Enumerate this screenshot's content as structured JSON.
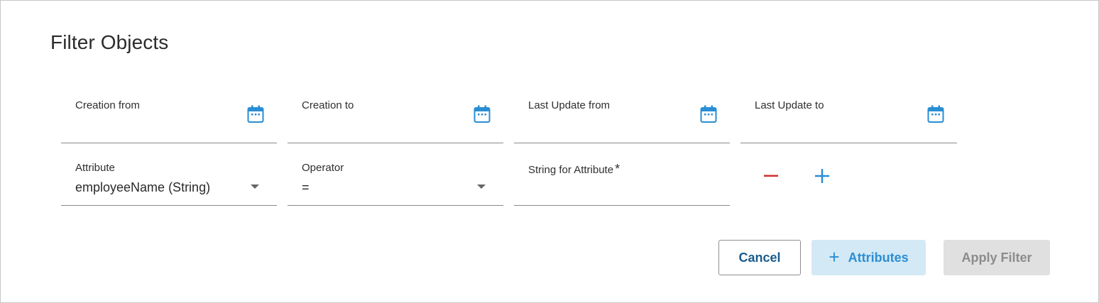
{
  "dialog": {
    "title": "Filter Objects"
  },
  "dates": [
    {
      "label": "Creation from",
      "value": "",
      "icon": "calendar-icon"
    },
    {
      "label": "Creation to",
      "value": "",
      "icon": "calendar-icon"
    },
    {
      "label": "Last Update from",
      "value": "",
      "icon": "calendar-icon"
    },
    {
      "label": "Last Update to",
      "value": "",
      "icon": "calendar-icon"
    }
  ],
  "attribute_row": {
    "attribute": {
      "label": "Attribute",
      "value": "employeeName (String)"
    },
    "operator": {
      "label": "Operator",
      "value": "="
    },
    "string": {
      "label": "String for Attribute",
      "required_mark": "*",
      "value": ""
    },
    "remove_icon": "minus-icon",
    "add_icon": "plus-icon"
  },
  "buttons": {
    "cancel": "Cancel",
    "attributes_plus": "+",
    "attributes": "Attributes",
    "apply": "Apply Filter"
  },
  "colors": {
    "accent": "#2a8ed4",
    "remove": "#d32f2f",
    "primary_text": "#1a5c8c",
    "disabled_bg": "#e0e0e0"
  }
}
